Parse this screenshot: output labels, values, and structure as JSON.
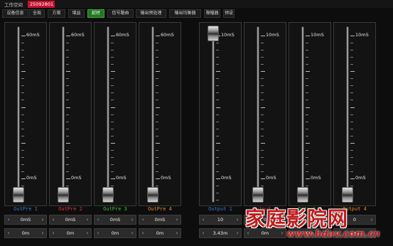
{
  "workspace": {
    "label": "工作空间",
    "id": "25092801"
  },
  "tabs": [
    {
      "label": "设备信息",
      "active": false
    },
    {
      "label": "全局",
      "active": false
    },
    {
      "label": "方案",
      "active": false
    },
    {
      "label": "增益",
      "active": false
    },
    {
      "label": "延时",
      "active": true
    },
    {
      "label": "信号路由",
      "active": false
    },
    {
      "label": "输出预处理",
      "active": false
    },
    {
      "label": "输出均衡器",
      "active": false
    },
    {
      "label": "限幅器",
      "active": false
    },
    {
      "label": "预设",
      "active": false
    }
  ],
  "channels": [
    {
      "name": "OutPre 1",
      "color": "#3a7bd5",
      "max": "60mS",
      "min": "0mS",
      "level": 0,
      "delay_ms": "0mS",
      "distance": "0m"
    },
    {
      "name": "OutPre 2",
      "color": "#d93b3b",
      "max": "60mS",
      "min": "0mS",
      "level": 0,
      "delay_ms": "0mS",
      "distance": "0m"
    },
    {
      "name": "OutPre 3",
      "color": "#3fbf3f",
      "max": "60mS",
      "min": "0mS",
      "level": 0,
      "delay_ms": "0mS",
      "distance": "0m"
    },
    {
      "name": "OutPre 4",
      "color": "#e0902a",
      "max": "60mS",
      "min": "0mS",
      "level": 0,
      "delay_ms": "0mS",
      "distance": "0m"
    },
    {
      "name": "Output 1",
      "color": "#3a7bd5",
      "max": "10mS",
      "min": "0mS",
      "level": 1,
      "delay_ms": "10",
      "distance": "3.43m"
    },
    {
      "name": "Output 2",
      "color": "#d93b3b",
      "max": "10mS",
      "min": "0mS",
      "level": 0,
      "delay_ms": "0",
      "distance": "0m"
    },
    {
      "name": "Output 3",
      "color": "#3fbf3f",
      "max": "10mS",
      "min": "0mS",
      "level": 0,
      "delay_ms": "0",
      "distance": "0m"
    },
    {
      "name": "Output 4",
      "color": "#e0902a",
      "max": "10mS",
      "min": "0mS",
      "level": 0,
      "delay_ms": "0",
      "distance": "0m"
    }
  ],
  "watermark": {
    "title": "家庭影院网",
    "url": "www.hdav.com.cn"
  },
  "icons": {
    "decrement": "chevron-left-icon",
    "increment": "chevron-right-icon"
  }
}
